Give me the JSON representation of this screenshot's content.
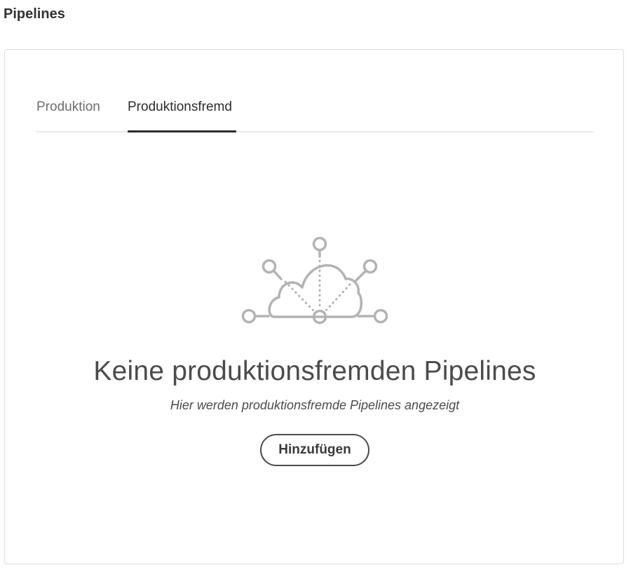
{
  "page": {
    "title": "Pipelines"
  },
  "tabs": [
    {
      "label": "Produktion",
      "selected": false
    },
    {
      "label": "Produktionsfremd",
      "selected": true
    }
  ],
  "empty_state": {
    "icon": "cloud-network-icon",
    "heading": "Keine produktionsfremden Pipelines",
    "description": "Hier werden produktionsfremde Pipelines angezeigt",
    "button_label": "Hinzufügen"
  },
  "colors": {
    "text_primary": "#2c2c2c",
    "text_secondary": "#6e6e6e",
    "icon_gray": "#b3b3b3",
    "border": "#dcdcdc"
  }
}
